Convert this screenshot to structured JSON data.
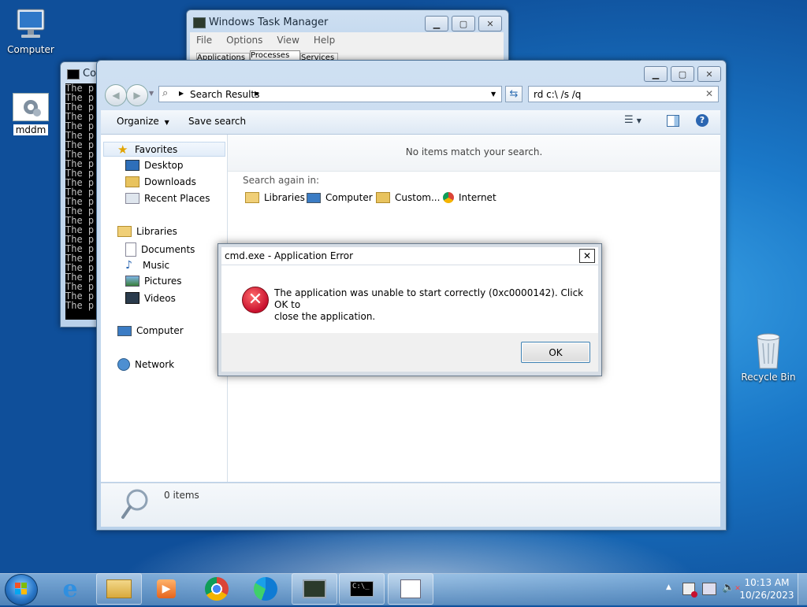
{
  "desktop": {
    "icons": [
      {
        "label": "Computer",
        "icon": "computer-icon"
      },
      {
        "label": "mddm",
        "icon": "gear-file-icon"
      },
      {
        "label": "Recycle Bin",
        "icon": "recycle-bin-icon"
      }
    ]
  },
  "task_manager": {
    "title": "Windows Task Manager",
    "menu": [
      "File",
      "Options",
      "View",
      "Help"
    ],
    "tabs": [
      "Applications",
      "Processes",
      "Services"
    ]
  },
  "console": {
    "title": "Co",
    "lines": [
      "The p",
      "The p",
      "The p",
      "The p",
      "The p",
      "The p",
      "The p",
      "The p",
      "The p",
      "The p",
      "The p",
      "The p",
      "The p",
      "The p",
      "The p",
      "The p",
      "The p",
      "The p",
      "The p",
      "The p",
      "The p",
      "The p",
      "The p",
      "The p"
    ]
  },
  "explorer": {
    "address": "Search Results",
    "search_value": "rd c:\\ /s /q",
    "toolbar": {
      "organize": "Organize",
      "save_search": "Save search"
    },
    "nav": {
      "favorites": "Favorites",
      "desktop": "Desktop",
      "downloads": "Downloads",
      "recent": "Recent Places",
      "libraries": "Libraries",
      "documents": "Documents",
      "music": "Music",
      "pictures": "Pictures",
      "videos": "Videos",
      "computer": "Computer",
      "network": "Network"
    },
    "no_items": "No items match your search.",
    "search_again": "Search again in:",
    "search_locations": [
      "Libraries",
      "Computer",
      "Custom...",
      "Internet"
    ],
    "status": "0 items"
  },
  "dialog": {
    "title": "cmd.exe - Application Error",
    "message_line1": "The application was unable to start correctly (0xc0000142). Click OK to",
    "message_line2": "close the application.",
    "ok": "OK"
  },
  "taskbar": {
    "time": "10:13 AM",
    "date": "10/26/2023",
    "apps": [
      "start-orb",
      "ie-icon",
      "explorer-icon",
      "media-player-icon",
      "chrome-icon",
      "edge-icon",
      "task-manager-icon",
      "cmd-icon",
      "document-icon"
    ]
  },
  "colors": {
    "accent": "#3a78c2",
    "error": "#c8102e",
    "ok_border": "#3c7fb1"
  }
}
